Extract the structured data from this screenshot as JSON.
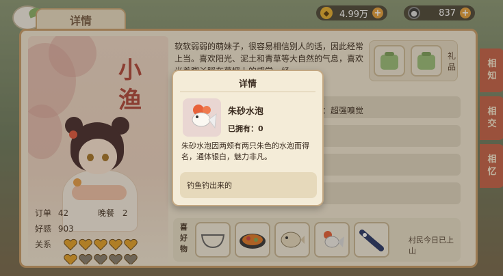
{
  "header": {
    "title": "详情"
  },
  "currency": [
    {
      "value": "4.99万",
      "icon": "coin-icon",
      "color": "#e6b032"
    },
    {
      "value": "837",
      "icon": "gem-icon",
      "color": "#5d5d5d"
    }
  ],
  "character": {
    "name_chars": [
      "小",
      "渔"
    ],
    "stats": {
      "order_label": "订单",
      "order_value": "42",
      "dinner_label": "晚餐",
      "dinner_value": "2",
      "favor_label": "好感",
      "favor_value": "903",
      "relation_label": "关系"
    },
    "hearts_filled": 6,
    "hearts_total": 10,
    "description": "软软弱弱的萌妹子，很容易相信别人的话，因此经常上当。喜欢阳光、泥土和青草等大自然的气息，喜欢光着脚丫踩在草坪上的感觉，经"
  },
  "gifts": {
    "label": "礼品",
    "items": [
      "已领取",
      "已领取"
    ]
  },
  "rows": {
    "trait_text": "：超强嗅觉"
  },
  "side_tabs": [
    "相知",
    "相交",
    "相忆"
  ],
  "preferences": {
    "label": "喜好物",
    "items": [
      "bowl-icon",
      "dish-icon",
      "pufferfish-icon",
      "goldfish-icon",
      "fish-icon"
    ],
    "status": "村民今日已上山"
  },
  "modal": {
    "title": "详情",
    "item_name": "朱砂水泡",
    "owned": "已拥有：0",
    "description": "朱砂水泡因两颊有两只朱色的水泡而得名，通体银白，魅力非凡。",
    "source": "钓鱼钓出来的"
  }
}
